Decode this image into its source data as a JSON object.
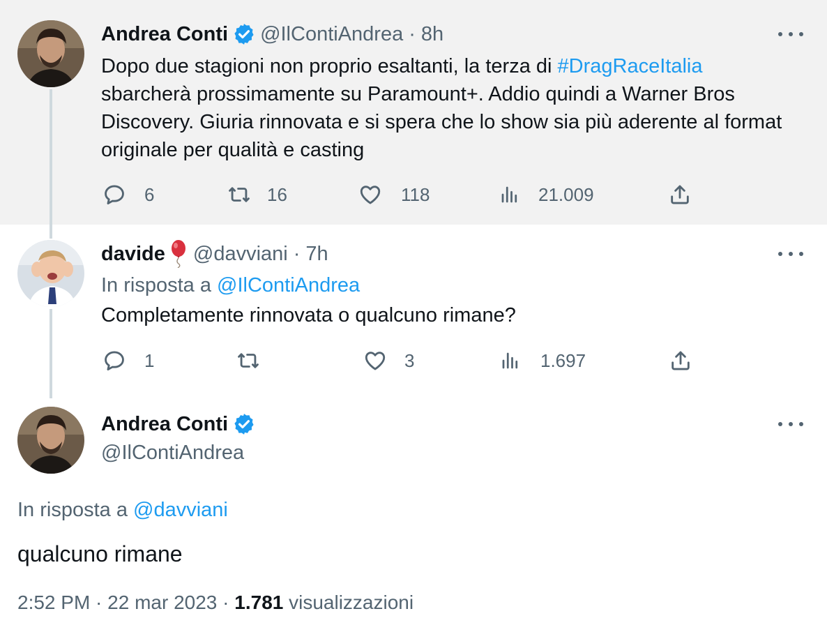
{
  "tweet1": {
    "name": "Andrea Conti",
    "handle": "@IlContiAndrea",
    "sep": "·",
    "time": "8h",
    "text_before": "Dopo due stagioni non proprio esaltanti, la terza di ",
    "hashtag": "#DragRaceItalia",
    "text_after": " sbarcherà prossimamente su Paramount+. Addio quindi a Warner Bros Discovery. Giuria rinnovata e si spera che lo show sia più aderente al format originale per qualità e casting",
    "replies": "6",
    "retweets": "16",
    "likes": "118",
    "views": "21.009"
  },
  "tweet2": {
    "name": "davide",
    "handle": "@davviani",
    "sep": "·",
    "time": "7h",
    "reply_prefix": "In risposta a ",
    "reply_to": "@IlContiAndrea",
    "text": "Completamente rinnovata o qualcuno rimane?",
    "replies": "1",
    "retweets": "",
    "likes": "3",
    "views": "1.697"
  },
  "tweet3": {
    "name": "Andrea Conti",
    "handle": "@IlContiAndrea",
    "reply_prefix": "In risposta a ",
    "reply_to": "@davviani",
    "text": "qualcuno rimane",
    "timestamp": "2:52 PM · 22 mar 2023 · ",
    "views_count": "1.781",
    "views_label": " visualizzazioni"
  },
  "colors": {
    "link": "#1d9bf0",
    "secondary": "#536471",
    "highlight_bg": "#f2f2f2"
  },
  "icons": [
    "verified-badge-icon",
    "balloon-emoji-icon",
    "more-icon",
    "reply-icon",
    "retweet-icon",
    "like-icon",
    "views-icon",
    "share-icon"
  ]
}
